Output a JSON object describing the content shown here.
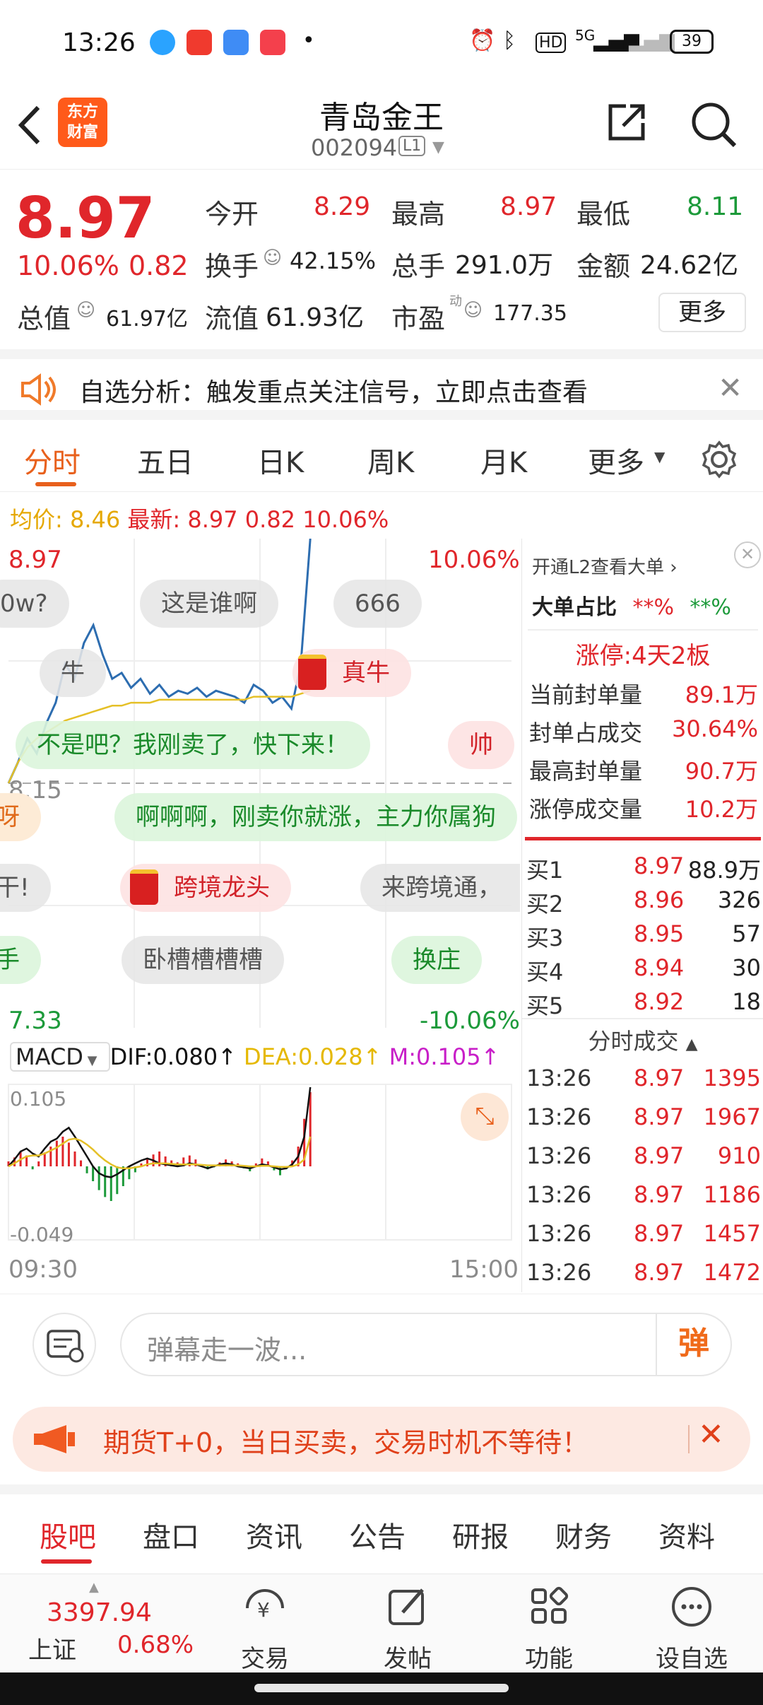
{
  "status_bar": {
    "time": "13:26",
    "battery": "39",
    "network": "5G",
    "icons": [
      "qq-browser-icon",
      "video-app-icon",
      "blue-app-icon",
      "music-app-icon",
      "dot-icon",
      "alarm-icon",
      "bluetooth-icon",
      "hd-icon",
      "signal-icon"
    ]
  },
  "header": {
    "back_icon": "chevron-left-icon",
    "logo_line1": "东方",
    "logo_line2": "财富",
    "title": "青岛金王",
    "code": "002094",
    "level": "L1",
    "share_icon": "share-icon",
    "search_icon": "search-icon"
  },
  "quote": {
    "price": "8.97",
    "change_pct": "10.06%",
    "change": "0.82",
    "open_label": "今开",
    "open": "8.29",
    "high_label": "最高",
    "high": "8.97",
    "low_label": "最低",
    "low": "8.11",
    "turnover_label": "换手",
    "turnover": "42.15%",
    "volume_label": "总手",
    "volume": "291.0万",
    "amount_label": "金额",
    "amount": "24.62亿",
    "mktcap_label": "总值",
    "mktcap": "61.97亿",
    "float_label": "流值",
    "float_cap": "61.93亿",
    "pe_label": "市盈",
    "pe_sup": "动",
    "pe": "177.35",
    "more_button": "更多"
  },
  "notice": {
    "text": "自选分析：触发重点关注信号，立即点击查看"
  },
  "chart_tabs": [
    "分时",
    "五日",
    "日K",
    "周K",
    "月K",
    "更多"
  ],
  "intraday": {
    "avg_label": "均价:",
    "avg": "8.46",
    "latest_label": "最新:",
    "latest": "8.97",
    "chg": "0.82",
    "pct": "10.06%",
    "top_price": "8.97",
    "top_pct": "10.06%",
    "mid_price": "8.15",
    "bot_price": "7.33",
    "bot_pct": "-10.06%",
    "time_start": "09:30",
    "time_end": "15:00"
  },
  "chart_data": {
    "type": "line",
    "x_range": [
      "09:30",
      "15:00"
    ],
    "ylim": [
      7.33,
      8.97
    ],
    "series": [
      {
        "values": [
          8.15,
          8.22,
          8.3,
          8.25,
          8.35,
          8.42,
          8.55,
          8.5,
          8.62,
          8.68,
          8.58,
          8.5,
          8.52,
          8.47,
          8.5,
          8.45,
          8.48,
          8.44,
          8.46,
          8.45,
          8.47,
          8.44,
          8.46,
          8.45,
          8.44,
          8.42,
          8.48,
          8.46,
          8.42,
          8.44,
          8.4,
          8.55,
          8.97
        ]
      },
      {
        "values": [
          8.15,
          8.22,
          8.27,
          8.3,
          8.32,
          8.34,
          8.36,
          8.37,
          8.38,
          8.39,
          8.4,
          8.41,
          8.41,
          8.42,
          8.42,
          8.42,
          8.43,
          8.43,
          8.43,
          8.43,
          8.43,
          8.43,
          8.43,
          8.43,
          8.43,
          8.43,
          8.44,
          8.44,
          8.44,
          8.44,
          8.44,
          8.45,
          8.46
        ]
      }
    ]
  },
  "danmu_bubbles": [
    {
      "text": "0w?",
      "style": "gray"
    },
    {
      "text": "这是谁啊",
      "style": "gray"
    },
    {
      "text": "666",
      "style": "gray"
    },
    {
      "text": "牛",
      "style": "gray"
    },
    {
      "text": "真牛",
      "style": "red"
    },
    {
      "text": "不是吧？我刚卖了，快下来！",
      "style": "green"
    },
    {
      "text": "帅",
      "style": "red"
    },
    {
      "text": "呀",
      "style": "red"
    },
    {
      "text": "啊啊啊，刚卖你就涨，主力你属狗",
      "style": "green"
    },
    {
      "text": "干!",
      "style": "gray"
    },
    {
      "text": "跨境龙头",
      "style": "red"
    },
    {
      "text": "来跨境通，",
      "style": "gray"
    },
    {
      "text": "手",
      "style": "green"
    },
    {
      "text": "卧槽槽槽槽",
      "style": "gray"
    },
    {
      "text": "换庄",
      "style": "green"
    }
  ],
  "macd": {
    "label": "MACD",
    "dif": "DIF:0.080",
    "dea": "DEA:0.028",
    "m": "M:0.105",
    "top": "0.105",
    "bottom": "-0.049",
    "dif_color": "#111111",
    "dea_color": "#e5b800",
    "m_color": "#c81fc8"
  },
  "right_panel": {
    "l2_text": "开通L2查看大单",
    "big_label": "大单占比",
    "big_v1": "**%",
    "big_v2": "**%",
    "limit_label": "涨停:",
    "limit_value": "4天2板",
    "stats": [
      {
        "label": "当前封单量",
        "value": "89.1万"
      },
      {
        "label": "封单占成交",
        "value": "30.64%"
      },
      {
        "label": "最高封单量",
        "value": "90.7万"
      },
      {
        "label": "涨停成交量",
        "value": "10.2万"
      }
    ],
    "bids": [
      {
        "label": "买1",
        "price": "8.97",
        "vol": "88.9万"
      },
      {
        "label": "买2",
        "price": "8.96",
        "vol": "326"
      },
      {
        "label": "买3",
        "price": "8.95",
        "vol": "57"
      },
      {
        "label": "买4",
        "price": "8.94",
        "vol": "30"
      },
      {
        "label": "买5",
        "price": "8.92",
        "vol": "18"
      }
    ],
    "trades_title": "分时成交",
    "trades": [
      {
        "time": "13:26",
        "price": "8.97",
        "vol": "1395"
      },
      {
        "time": "13:26",
        "price": "8.97",
        "vol": "1967"
      },
      {
        "time": "13:26",
        "price": "8.97",
        "vol": "910"
      },
      {
        "time": "13:26",
        "price": "8.97",
        "vol": "1186"
      },
      {
        "time": "13:26",
        "price": "8.97",
        "vol": "1457"
      },
      {
        "time": "13:26",
        "price": "8.97",
        "vol": "1472"
      }
    ]
  },
  "danmu_input": {
    "placeholder": "弹幕走一波...",
    "send_label": "弹"
  },
  "futures_banner": {
    "text": "期货T+0，当日买卖，交易时机不等待！"
  },
  "sub_tabs": [
    "股吧",
    "盘口",
    "资讯",
    "公告",
    "研报",
    "财务",
    "资料"
  ],
  "bottom_nav": {
    "index_value": "3397.94",
    "index_name": "上证",
    "index_pct": "0.68%",
    "items": [
      "交易",
      "发帖",
      "功能",
      "设自选"
    ]
  }
}
